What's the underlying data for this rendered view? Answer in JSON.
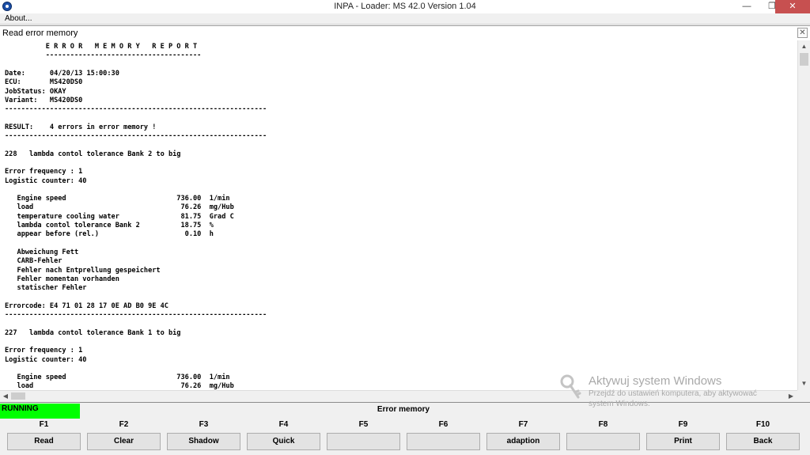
{
  "window": {
    "title": "INPA - Loader:  MS 42.0 Version 1.04",
    "controls": {
      "minimize": "—",
      "maximize": "❐",
      "close": "✕"
    }
  },
  "menu": {
    "items": [
      "About..."
    ]
  },
  "panel": {
    "title": "Read error memory",
    "close_glyph": "✕"
  },
  "report": {
    "lines": [
      "          E R R O R   M E M O R Y   R E P O R T",
      "          --------------------------------------",
      "",
      "Date:      04/20/13 15:00:30",
      "ECU:       MS420DS0",
      "JobStatus: OKAY",
      "Variant:   MS420DS0",
      "----------------------------------------------------------------",
      "",
      "RESULT:    4 errors in error memory !",
      "----------------------------------------------------------------",
      "",
      "228   lambda contol tolerance Bank 2 to big",
      "",
      "Error frequency : 1",
      "Logistic counter: 40",
      "",
      "   Engine speed                           736.00  1/min",
      "   load                                    76.26  mg/Hub",
      "   temperature cooling water               81.75  Grad C",
      "   lambda contol tolerance Bank 2          18.75  %",
      "   appear before (rel.)                     0.10  h",
      "",
      "   Abweichung Fett",
      "   CARB-Fehler",
      "   Fehler nach Entprellung gespeichert",
      "   Fehler momentan vorhanden",
      "   statischer Fehler",
      "",
      "Errorcode: E4 71 01 28 17 0E AD B0 9E 4C",
      "----------------------------------------------------------------",
      "",
      "227   lambda contol tolerance Bank 1 to big",
      "",
      "Error frequency : 1",
      "Logistic counter: 40",
      "",
      "   Engine speed                           736.00  1/min",
      "   load                                    76.26  mg/Hub"
    ]
  },
  "scrollbars": {
    "up": "▲",
    "down": "▼",
    "left": "◀",
    "right": "▶"
  },
  "status": {
    "left": "RUNNING",
    "center": "Error memory"
  },
  "function_keys": [
    {
      "key": "F1",
      "label": "Read"
    },
    {
      "key": "F2",
      "label": "Clear"
    },
    {
      "key": "F3",
      "label": "Shadow"
    },
    {
      "key": "F4",
      "label": "Quick"
    },
    {
      "key": "F5",
      "label": ""
    },
    {
      "key": "F6",
      "label": ""
    },
    {
      "key": "F7",
      "label": "adaption"
    },
    {
      "key": "F8",
      "label": ""
    },
    {
      "key": "F9",
      "label": "Print"
    },
    {
      "key": "F10",
      "label": "Back"
    }
  ],
  "watermark": {
    "icon": "key-icon",
    "title": "Aktywuj system Windows",
    "line1": "Przejdź do ustawień komputera, aby aktywować",
    "line2": "system Windows."
  },
  "colors": {
    "running": "#00ff00",
    "close_button": "#c75050"
  }
}
